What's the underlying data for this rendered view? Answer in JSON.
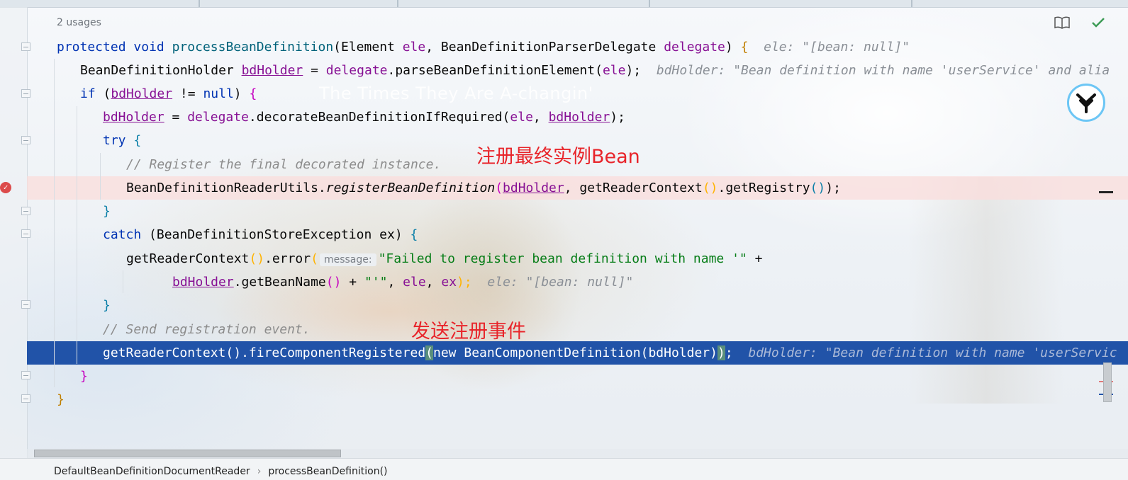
{
  "editor": {
    "usages": "2 usages",
    "lines": {
      "l1": {
        "kw1": "protected",
        "kw2": "void",
        "fn": "processBeanDefinition",
        "p1": "(Element ",
        "v1": "ele",
        ", ": ", ",
        "p2": "BeanDefinitionParserDelegate ",
        "v2": "delegate",
        "close": ") ",
        "brace": "{",
        "hint": "ele: \"[bean: null]\""
      },
      "l2": {
        "type": "BeanDefinitionHolder ",
        "v1": "bdHolder",
        "eq": " = ",
        "v2": "delegate",
        "call": ".parseBeanDefinitionElement(",
        "v3": "ele",
        "end": ");",
        "hint": "bdHolder: \"Bean definition with name 'userService' and alia"
      },
      "l3": {
        "kw": "if",
        "open": " (",
        "v1": "bdHolder",
        "op": " != ",
        "kw2": "null",
        ") ": ") ",
        "brace": "{"
      },
      "l4": {
        "v1": "bdHolder",
        "eq": " = ",
        "v2": "delegate",
        "call": ".decorateBeanDefinitionIfRequired(",
        "v3": "ele",
        "sep": ", ",
        "v4": "bdHolder",
        "end": ");"
      },
      "l5": {
        "kw": "try",
        "brace": "{"
      },
      "l6": {
        "comment": "// Register the final decorated instance."
      },
      "l7": {
        "cls": "BeanDefinitionReaderUtils.",
        "fn": "registerBeanDefinition",
        "open": "(",
        "v1": "bdHolder",
        "mid": ", getReaderContext",
        "p1": "()",
        "get": ".getRegistry",
        "p2": "()",
        "end": ");"
      },
      "l8": {
        "brace": "}"
      },
      "l9": {
        "kw": "catch",
        "mid": " (BeanDefinitionStoreException ",
        "v1": "ex",
        ")": ") ",
        "brace": "{"
      },
      "l10": {
        "call": "getReaderContext",
        "p": "()",
        "err": ".error",
        "open": "(",
        "label": "message:",
        "str": "\"Failed to register bean definition with name '\"",
        "plus": " +"
      },
      "l11": {
        "v1": "bdHolder",
        "call": ".getBeanName",
        "p": "()",
        "plus": " + ",
        "str": "\"'\"",
        "sep": ", ",
        "v2": "ele",
        "sep2": ", ",
        "v3": "ex",
        "end": ");",
        "hint": "ele: \"[bean: null]\""
      },
      "l12": {
        "brace": "}"
      },
      "l13": {
        "comment": "// Send registration event."
      },
      "l14": {
        "call": "getReaderContext().fireComponentRegistered",
        "open": "(",
        "kw": "new",
        "mid": " BeanComponentDefinition(bdHolder)",
        "close": ")",
        "end": ";",
        "hint": "bdHolder: \"Bean definition with name 'userServic"
      },
      "l15": {
        "brace": "}"
      },
      "l16": {
        "brace": "}"
      }
    }
  },
  "annotations": {
    "register": "注册最终实例Bean",
    "event": "发送注册事件"
  },
  "watermark": "The Times They Are A-changin'",
  "statusbar": {
    "class_name": "DefaultBeanDefinitionDocumentReader",
    "separator": "›",
    "method_name": "processBeanDefinition()"
  },
  "colors": {
    "keyword": "#0033b3",
    "function": "#00627a",
    "field": "#871094",
    "string": "#067d17",
    "comment": "#8c8c8c",
    "annotation": "#e8242a",
    "selection": "#2153a8"
  },
  "icons": {
    "reader_mode": "book-icon",
    "inspection": "checkmark-icon",
    "breakpoint": "breakpoint-icon",
    "plugin": "plugin-logo-icon"
  }
}
